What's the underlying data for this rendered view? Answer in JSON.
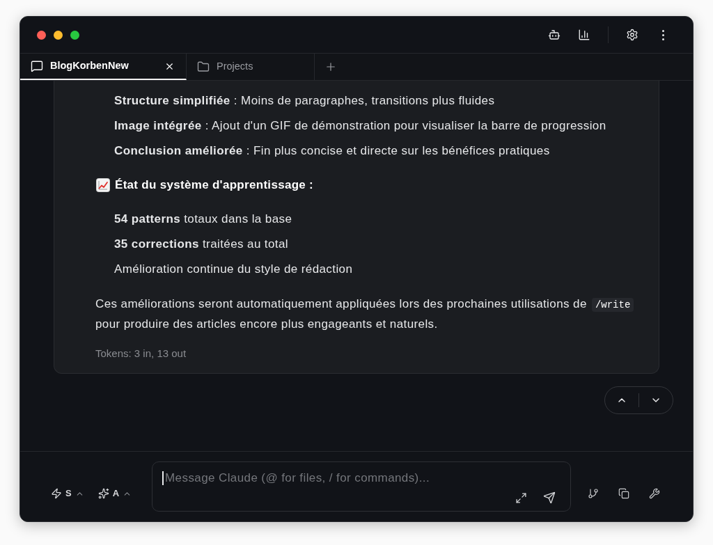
{
  "tabs": [
    {
      "label": "BlogKorbenNew",
      "selected": true,
      "kind": "chat"
    },
    {
      "label": "Projects",
      "selected": false,
      "kind": "folder"
    }
  ],
  "message": {
    "sections": [
      {
        "kind": "list",
        "items": [
          "**Structure simplifiée** : Moins de paragraphes, transitions plus fluides",
          "**Image intégrée** : Ajout d'un GIF de démonstration pour visualiser la barre de progression",
          "**Conclusion améliorée** : Fin plus concise et directe sur les bénéfices pratiques"
        ]
      },
      {
        "kind": "heading",
        "text": "État du système d'apprentissage :"
      },
      {
        "kind": "list",
        "items": [
          "**54 patterns** totaux dans la base",
          "**35 corrections** traitées au total",
          "Amélioration continue du style de rédaction"
        ]
      },
      {
        "kind": "paragraph",
        "before": "Ces améliorations seront automatiquement appliquées lors des prochaines utilisations de",
        "code": "/write",
        "after": "pour produire des articles encore plus engageants et naturels."
      }
    ],
    "tokens": "Tokens: 3 in, 13 out"
  },
  "composer": {
    "mode_buttons": [
      {
        "label": "S",
        "kind": "speed"
      },
      {
        "label": "A",
        "kind": "agent"
      }
    ],
    "input": {
      "placeholder": "Message Claude (@ for files, / for commands)...",
      "focused": true
    }
  }
}
